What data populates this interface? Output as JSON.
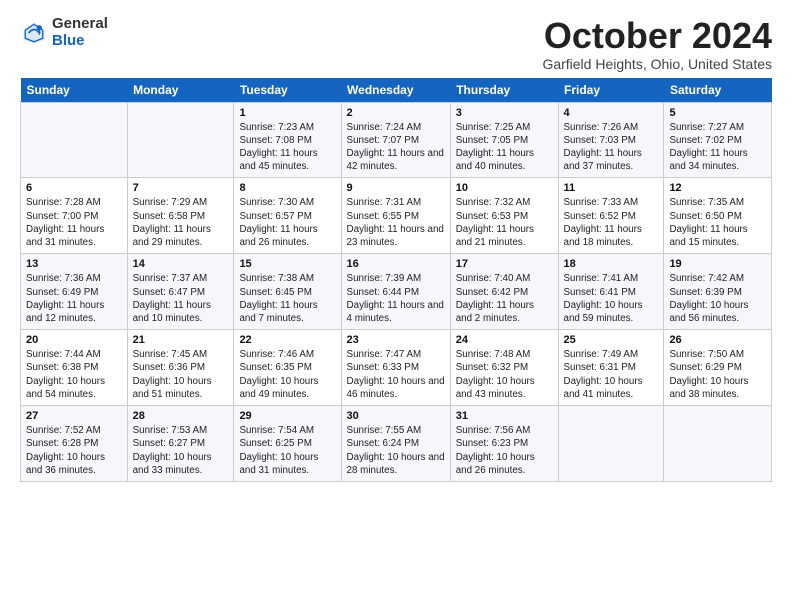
{
  "header": {
    "logo_general": "General",
    "logo_blue": "Blue",
    "title": "October 2024",
    "location": "Garfield Heights, Ohio, United States"
  },
  "weekdays": [
    "Sunday",
    "Monday",
    "Tuesday",
    "Wednesday",
    "Thursday",
    "Friday",
    "Saturday"
  ],
  "weeks": [
    [
      {
        "day": "",
        "sunrise": "",
        "sunset": "",
        "daylight": ""
      },
      {
        "day": "",
        "sunrise": "",
        "sunset": "",
        "daylight": ""
      },
      {
        "day": "1",
        "sunrise": "Sunrise: 7:23 AM",
        "sunset": "Sunset: 7:08 PM",
        "daylight": "Daylight: 11 hours and 45 minutes."
      },
      {
        "day": "2",
        "sunrise": "Sunrise: 7:24 AM",
        "sunset": "Sunset: 7:07 PM",
        "daylight": "Daylight: 11 hours and 42 minutes."
      },
      {
        "day": "3",
        "sunrise": "Sunrise: 7:25 AM",
        "sunset": "Sunset: 7:05 PM",
        "daylight": "Daylight: 11 hours and 40 minutes."
      },
      {
        "day": "4",
        "sunrise": "Sunrise: 7:26 AM",
        "sunset": "Sunset: 7:03 PM",
        "daylight": "Daylight: 11 hours and 37 minutes."
      },
      {
        "day": "5",
        "sunrise": "Sunrise: 7:27 AM",
        "sunset": "Sunset: 7:02 PM",
        "daylight": "Daylight: 11 hours and 34 minutes."
      }
    ],
    [
      {
        "day": "6",
        "sunrise": "Sunrise: 7:28 AM",
        "sunset": "Sunset: 7:00 PM",
        "daylight": "Daylight: 11 hours and 31 minutes."
      },
      {
        "day": "7",
        "sunrise": "Sunrise: 7:29 AM",
        "sunset": "Sunset: 6:58 PM",
        "daylight": "Daylight: 11 hours and 29 minutes."
      },
      {
        "day": "8",
        "sunrise": "Sunrise: 7:30 AM",
        "sunset": "Sunset: 6:57 PM",
        "daylight": "Daylight: 11 hours and 26 minutes."
      },
      {
        "day": "9",
        "sunrise": "Sunrise: 7:31 AM",
        "sunset": "Sunset: 6:55 PM",
        "daylight": "Daylight: 11 hours and 23 minutes."
      },
      {
        "day": "10",
        "sunrise": "Sunrise: 7:32 AM",
        "sunset": "Sunset: 6:53 PM",
        "daylight": "Daylight: 11 hours and 21 minutes."
      },
      {
        "day": "11",
        "sunrise": "Sunrise: 7:33 AM",
        "sunset": "Sunset: 6:52 PM",
        "daylight": "Daylight: 11 hours and 18 minutes."
      },
      {
        "day": "12",
        "sunrise": "Sunrise: 7:35 AM",
        "sunset": "Sunset: 6:50 PM",
        "daylight": "Daylight: 11 hours and 15 minutes."
      }
    ],
    [
      {
        "day": "13",
        "sunrise": "Sunrise: 7:36 AM",
        "sunset": "Sunset: 6:49 PM",
        "daylight": "Daylight: 11 hours and 12 minutes."
      },
      {
        "day": "14",
        "sunrise": "Sunrise: 7:37 AM",
        "sunset": "Sunset: 6:47 PM",
        "daylight": "Daylight: 11 hours and 10 minutes."
      },
      {
        "day": "15",
        "sunrise": "Sunrise: 7:38 AM",
        "sunset": "Sunset: 6:45 PM",
        "daylight": "Daylight: 11 hours and 7 minutes."
      },
      {
        "day": "16",
        "sunrise": "Sunrise: 7:39 AM",
        "sunset": "Sunset: 6:44 PM",
        "daylight": "Daylight: 11 hours and 4 minutes."
      },
      {
        "day": "17",
        "sunrise": "Sunrise: 7:40 AM",
        "sunset": "Sunset: 6:42 PM",
        "daylight": "Daylight: 11 hours and 2 minutes."
      },
      {
        "day": "18",
        "sunrise": "Sunrise: 7:41 AM",
        "sunset": "Sunset: 6:41 PM",
        "daylight": "Daylight: 10 hours and 59 minutes."
      },
      {
        "day": "19",
        "sunrise": "Sunrise: 7:42 AM",
        "sunset": "Sunset: 6:39 PM",
        "daylight": "Daylight: 10 hours and 56 minutes."
      }
    ],
    [
      {
        "day": "20",
        "sunrise": "Sunrise: 7:44 AM",
        "sunset": "Sunset: 6:38 PM",
        "daylight": "Daylight: 10 hours and 54 minutes."
      },
      {
        "day": "21",
        "sunrise": "Sunrise: 7:45 AM",
        "sunset": "Sunset: 6:36 PM",
        "daylight": "Daylight: 10 hours and 51 minutes."
      },
      {
        "day": "22",
        "sunrise": "Sunrise: 7:46 AM",
        "sunset": "Sunset: 6:35 PM",
        "daylight": "Daylight: 10 hours and 49 minutes."
      },
      {
        "day": "23",
        "sunrise": "Sunrise: 7:47 AM",
        "sunset": "Sunset: 6:33 PM",
        "daylight": "Daylight: 10 hours and 46 minutes."
      },
      {
        "day": "24",
        "sunrise": "Sunrise: 7:48 AM",
        "sunset": "Sunset: 6:32 PM",
        "daylight": "Daylight: 10 hours and 43 minutes."
      },
      {
        "day": "25",
        "sunrise": "Sunrise: 7:49 AM",
        "sunset": "Sunset: 6:31 PM",
        "daylight": "Daylight: 10 hours and 41 minutes."
      },
      {
        "day": "26",
        "sunrise": "Sunrise: 7:50 AM",
        "sunset": "Sunset: 6:29 PM",
        "daylight": "Daylight: 10 hours and 38 minutes."
      }
    ],
    [
      {
        "day": "27",
        "sunrise": "Sunrise: 7:52 AM",
        "sunset": "Sunset: 6:28 PM",
        "daylight": "Daylight: 10 hours and 36 minutes."
      },
      {
        "day": "28",
        "sunrise": "Sunrise: 7:53 AM",
        "sunset": "Sunset: 6:27 PM",
        "daylight": "Daylight: 10 hours and 33 minutes."
      },
      {
        "day": "29",
        "sunrise": "Sunrise: 7:54 AM",
        "sunset": "Sunset: 6:25 PM",
        "daylight": "Daylight: 10 hours and 31 minutes."
      },
      {
        "day": "30",
        "sunrise": "Sunrise: 7:55 AM",
        "sunset": "Sunset: 6:24 PM",
        "daylight": "Daylight: 10 hours and 28 minutes."
      },
      {
        "day": "31",
        "sunrise": "Sunrise: 7:56 AM",
        "sunset": "Sunset: 6:23 PM",
        "daylight": "Daylight: 10 hours and 26 minutes."
      },
      {
        "day": "",
        "sunrise": "",
        "sunset": "",
        "daylight": ""
      },
      {
        "day": "",
        "sunrise": "",
        "sunset": "",
        "daylight": ""
      }
    ]
  ]
}
